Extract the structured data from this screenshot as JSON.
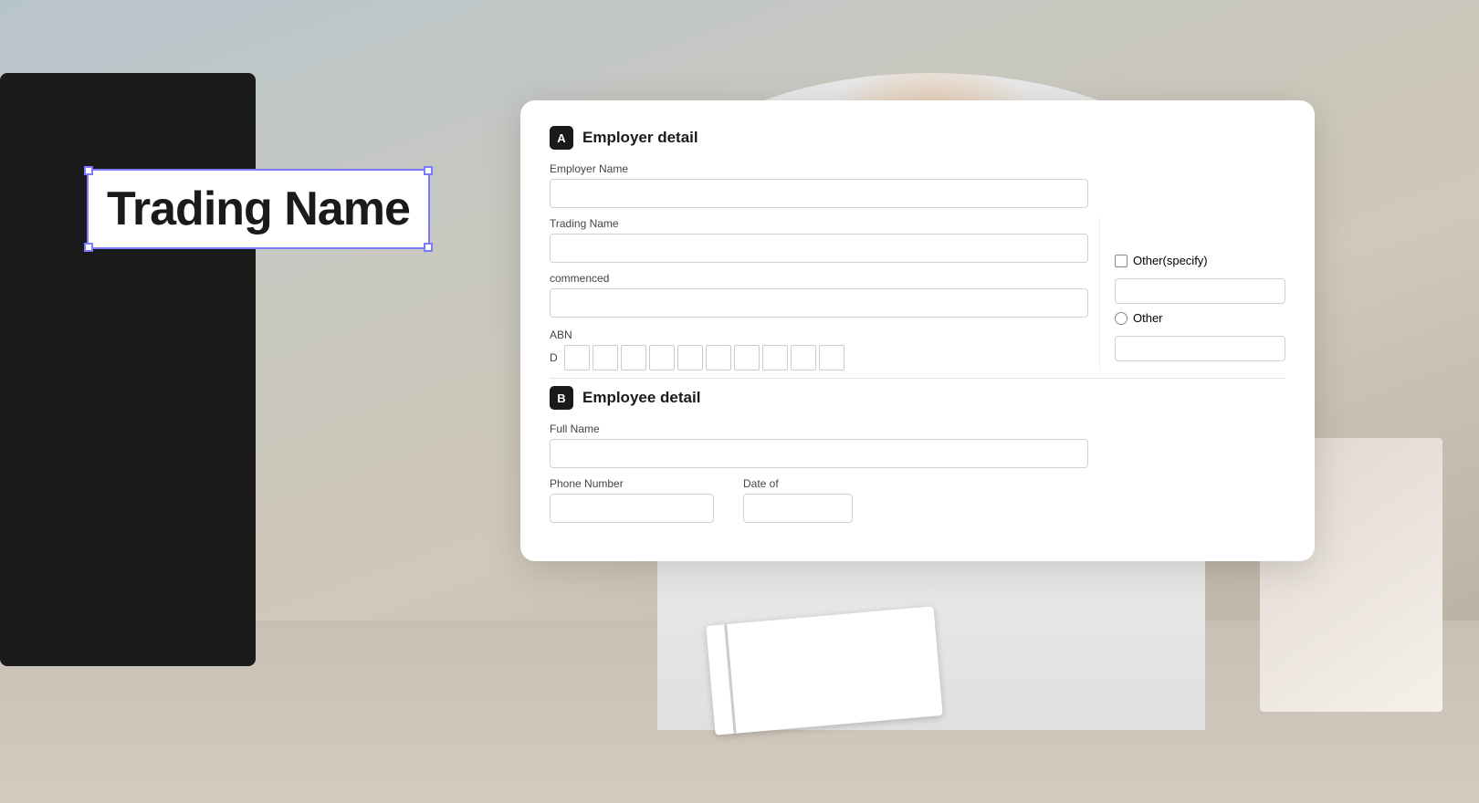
{
  "page": {
    "background_color": "#c8c4be"
  },
  "trading_name_overlay": {
    "text": "Trading Name"
  },
  "form": {
    "section_a": {
      "badge": "A",
      "title": "Employer detail",
      "employer_name_label": "Employer Name",
      "employer_name_value": "",
      "trading_name_label": "Trading Name",
      "trading_name_value": "",
      "date_commenced_label": "commenced",
      "date_commenced_value": "",
      "abn_label": "ABN",
      "abn_prefix": "D",
      "abn_cells": [
        "",
        "",
        "",
        "",
        "",
        "",
        "",
        "",
        "",
        ""
      ],
      "other_specify_label": "Other(specify)",
      "other_label": "Other",
      "other_input_value": ""
    },
    "section_b": {
      "badge": "B",
      "title": "Employee detail",
      "full_name_label": "Full Name",
      "full_name_value": "",
      "phone_number_label": "Phone Number",
      "phone_number_value": "",
      "date_of_label": "Date of",
      "date_of_value": ""
    }
  },
  "icons": {
    "checkbox": "☐",
    "radio": "○"
  }
}
